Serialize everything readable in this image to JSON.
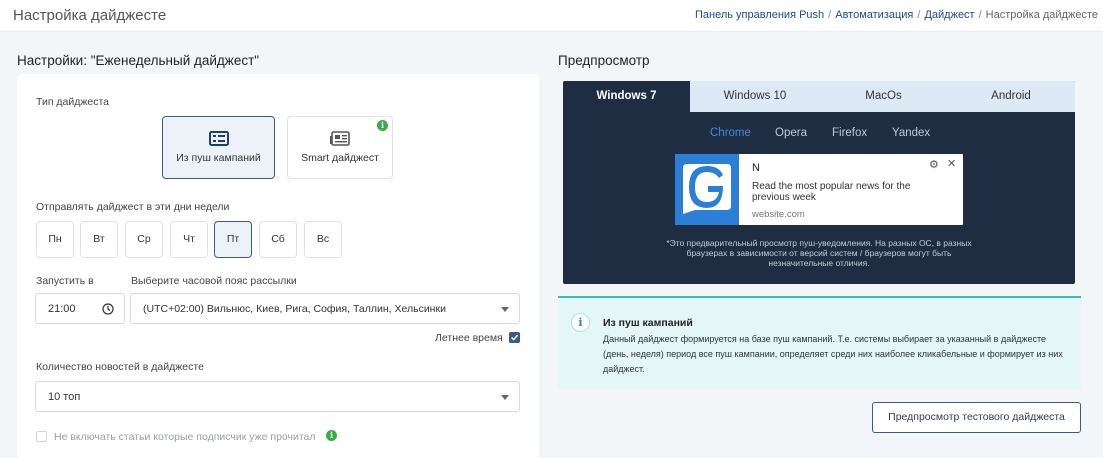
{
  "header": {
    "title": "Настройка дайджесте",
    "breadcrumb": {
      "items": [
        "Панель управления Push",
        "Автоматизация",
        "Дайджест"
      ],
      "current": "Настройка дайджесте",
      "separator": "/"
    }
  },
  "settings": {
    "title": "Настройки: \"Еженедельный дайджест\"",
    "digest_type": {
      "label": "Тип дайджеста",
      "options": [
        {
          "label": "Из пуш кампаний",
          "icon": "list-icon",
          "selected": true
        },
        {
          "label": "Smart дайджест",
          "icon": "newspaper-icon",
          "selected": false
        }
      ]
    },
    "days": {
      "label": "Отправлять дайджест в эти дни недели",
      "items": [
        {
          "label": "Пн",
          "selected": false
        },
        {
          "label": "Вт",
          "selected": false
        },
        {
          "label": "Ср",
          "selected": false
        },
        {
          "label": "Чт",
          "selected": false
        },
        {
          "label": "Пт",
          "selected": true
        },
        {
          "label": "Сб",
          "selected": false
        },
        {
          "label": "Вс",
          "selected": false
        }
      ]
    },
    "start": {
      "label": "Запустить в",
      "value": "21:00"
    },
    "timezone": {
      "label": "Выберите часовой пояс рассылки",
      "value": "(UTC+02:00) Вильнюс, Киев, Рига, София, Таллин, Хельсинки"
    },
    "summer_time": {
      "label": "Летнее время",
      "checked": true
    },
    "news_count": {
      "label": "Количество новостей в дайджесте",
      "value": "10 топ"
    },
    "exclude_read": {
      "label": "Не включать статьи которые подписчик уже прочитал",
      "checked": false
    }
  },
  "preview": {
    "title": "Предпросмотр",
    "os_tabs": [
      {
        "label": "Windows 7",
        "active": true
      },
      {
        "label": "Windows 10",
        "active": false
      },
      {
        "label": "MacOs",
        "active": false
      },
      {
        "label": "Android",
        "active": false
      }
    ],
    "browser_tabs": [
      {
        "label": "Chrome",
        "active": true
      },
      {
        "label": "Opera",
        "active": false
      },
      {
        "label": "Firefox",
        "active": false
      },
      {
        "label": "Yandex",
        "active": false
      }
    ],
    "notification": {
      "title": "N",
      "body": "Read the most popular news for the previous week",
      "site": "website.com"
    },
    "note": "*Это предварительный просмотр пуш-уведомления. На разных ОС, в разных браузерах в зависимости от версий систем / браузеров могут быть незначительные отличия."
  },
  "info": {
    "title": "Из пуш кампаний",
    "text": "Данный дайджест формируется на базе пуш кампаний. Т.е. системы выбирает за указанный в дайджесте (день, неделя) период все пуш кампании, определяет среди них наиболее кликабельные и формирует из них дайджест."
  },
  "test_button": {
    "label": "Предпросмотр тестового дайджеста"
  },
  "colors": {
    "accent": "#3a5b86",
    "preview_bg": "#1e2d42",
    "info_bg": "#e5f6f6",
    "info_border": "#33bdb6",
    "chrome_active": "#3f8de0",
    "badge_green": "#3aab4a"
  }
}
